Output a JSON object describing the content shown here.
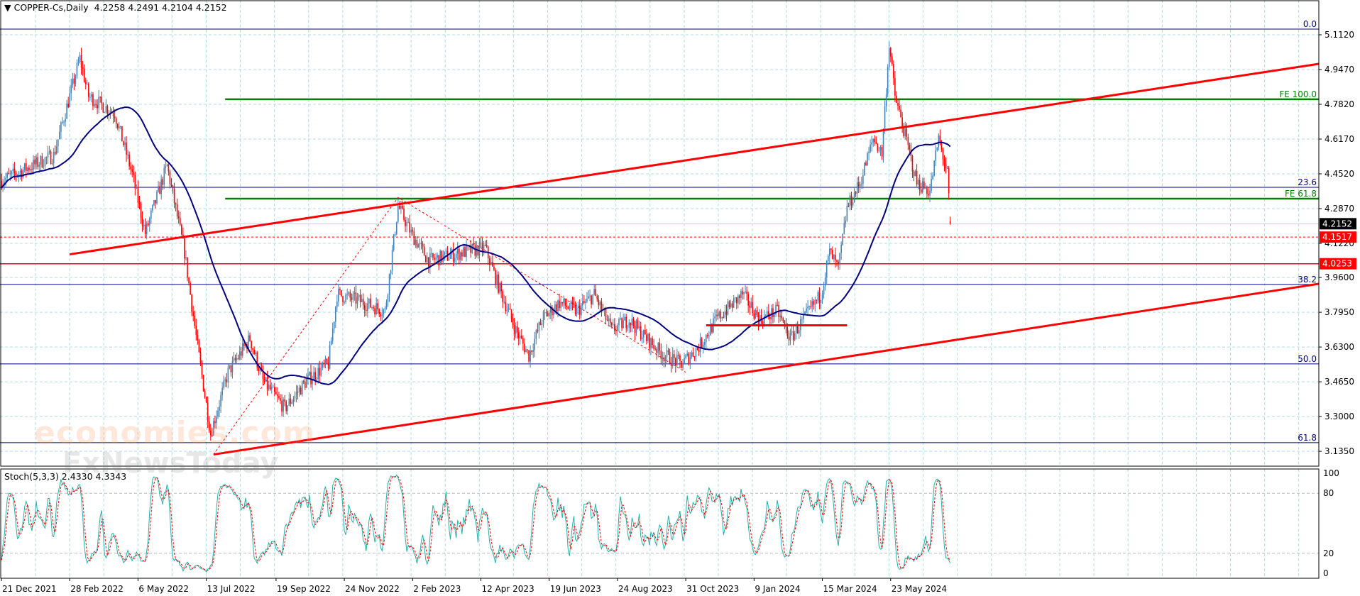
{
  "header": {
    "symbol": "COPPER-Cs,Daily",
    "open": "4.2258",
    "high": "4.2491",
    "low": "4.2104",
    "close": "4.2152"
  },
  "watermark": {
    "line1": "economies.com",
    "line2": "FxNewsToday"
  },
  "colors": {
    "bull": "#4682b4",
    "bear": "#ff0000",
    "ma": "#000080",
    "fib": "#000080",
    "fe": "#008000",
    "trend": "#ff0000",
    "stoch_main": "#20b2aa",
    "stoch_signal": "#ff0000",
    "grid": "#b0dde4"
  },
  "chart_data": {
    "type": "candlestick",
    "title": "COPPER-Cs,Daily",
    "ylim": [
      3.06,
      5.18
    ],
    "y_ticks": [
      "5.1120",
      "4.9470",
      "4.7820",
      "4.6170",
      "4.4520",
      "4.2870",
      "4.1220",
      "3.9600",
      "3.7950",
      "3.6300",
      "3.4650",
      "3.3000",
      "3.1350"
    ],
    "x_ticks": [
      {
        "bar": 0,
        "label": "21 Dec 2021"
      },
      {
        "bar": 47,
        "label": "28 Feb 2022"
      },
      {
        "bar": 94,
        "label": "6 May 2022"
      },
      {
        "bar": 141,
        "label": "13 Jul 2022"
      },
      {
        "bar": 189,
        "label": "19 Sep 2022"
      },
      {
        "bar": 236,
        "label": "24 Nov 2022"
      },
      {
        "bar": 283,
        "label": "2 Feb 2023"
      },
      {
        "bar": 330,
        "label": "12 Apr 2023"
      },
      {
        "bar": 377,
        "label": "19 Jun 2023"
      },
      {
        "bar": 424,
        "label": "24 Aug 2023"
      },
      {
        "bar": 471,
        "label": "31 Oct 2023"
      },
      {
        "bar": 518,
        "label": "9 Jan 2024"
      },
      {
        "bar": 565,
        "label": "15 Mar 2024"
      },
      {
        "bar": 612,
        "label": "23 May 2024"
      }
    ],
    "bars_total": 654,
    "price_path": [
      [
        0,
        4.42
      ],
      [
        36,
        4.54
      ],
      [
        54,
        5.0
      ],
      [
        60,
        4.82
      ],
      [
        78,
        4.74
      ],
      [
        90,
        4.45
      ],
      [
        99,
        4.17
      ],
      [
        114,
        4.49
      ],
      [
        126,
        4.08
      ],
      [
        135,
        3.63
      ],
      [
        144,
        3.22
      ],
      [
        156,
        3.51
      ],
      [
        171,
        3.67
      ],
      [
        180,
        3.47
      ],
      [
        195,
        3.34
      ],
      [
        210,
        3.47
      ],
      [
        225,
        3.55
      ],
      [
        231,
        3.88
      ],
      [
        246,
        3.85
      ],
      [
        264,
        3.8
      ],
      [
        273,
        4.3
      ],
      [
        282,
        4.17
      ],
      [
        294,
        4.04
      ],
      [
        318,
        4.08
      ],
      [
        333,
        4.1
      ],
      [
        342,
        3.92
      ],
      [
        354,
        3.71
      ],
      [
        363,
        3.59
      ],
      [
        372,
        3.76
      ],
      [
        384,
        3.84
      ],
      [
        396,
        3.8
      ],
      [
        408,
        3.88
      ],
      [
        420,
        3.71
      ],
      [
        432,
        3.76
      ],
      [
        444,
        3.67
      ],
      [
        456,
        3.59
      ],
      [
        468,
        3.55
      ],
      [
        480,
        3.63
      ],
      [
        492,
        3.76
      ],
      [
        510,
        3.88
      ],
      [
        522,
        3.76
      ],
      [
        534,
        3.8
      ],
      [
        543,
        3.67
      ],
      [
        552,
        3.76
      ],
      [
        564,
        3.88
      ],
      [
        570,
        4.08
      ],
      [
        576,
        4.0
      ],
      [
        582,
        4.29
      ],
      [
        591,
        4.41
      ],
      [
        600,
        4.62
      ],
      [
        606,
        4.55
      ],
      [
        611,
        5.07
      ],
      [
        615,
        4.82
      ],
      [
        621,
        4.66
      ],
      [
        630,
        4.41
      ],
      [
        639,
        4.37
      ],
      [
        645,
        4.62
      ],
      [
        651,
        4.45
      ],
      [
        653,
        4.2152
      ]
    ],
    "last_bar": {
      "open": 4.2258,
      "high": 4.2491,
      "low": 4.2104,
      "close": 4.2152
    },
    "moving_average_period": 50,
    "fibonacci_levels": [
      {
        "label": "0.0",
        "price": 5.139
      },
      {
        "label": "23.6",
        "price": 4.388
      },
      {
        "label": "38.2",
        "price": 3.927
      },
      {
        "label": "50.0",
        "price": 3.55
      },
      {
        "label": "61.8",
        "price": 3.176
      }
    ],
    "fibo_expansion": [
      {
        "label": "FE 100.0",
        "price": 4.806,
        "from_bar": 154
      },
      {
        "label": "FE 61.8",
        "price": 4.334,
        "from_bar": 154
      }
    ],
    "fibo_expansion_path": [
      [
        146,
        3.12
      ],
      [
        273,
        4.34
      ],
      [
        471,
        3.51
      ]
    ],
    "trendlines": [
      {
        "name": "upper-channel",
        "points": [
          [
            47,
            4.07
          ],
          [
            907,
            4.974
          ]
        ]
      },
      {
        "name": "lower-channel",
        "points": [
          [
            146,
            3.12
          ],
          [
            907,
            3.93
          ]
        ]
      },
      {
        "name": "support-segment",
        "points": [
          [
            485,
            3.733
          ],
          [
            582,
            3.733
          ]
        ]
      }
    ],
    "price_markers": [
      {
        "label": "4.2152",
        "price": 4.2152,
        "style": "current"
      },
      {
        "label": "4.1517",
        "price": 4.1517,
        "style": "dashed"
      },
      {
        "label": "4.0253",
        "price": 4.0253,
        "style": "solid"
      }
    ],
    "stochastic": {
      "title": "Stoch(5,3,3) 2.4330 4.3343",
      "params": [
        5,
        3,
        3
      ],
      "levels": [
        "100",
        "80",
        "20",
        "0"
      ]
    }
  }
}
